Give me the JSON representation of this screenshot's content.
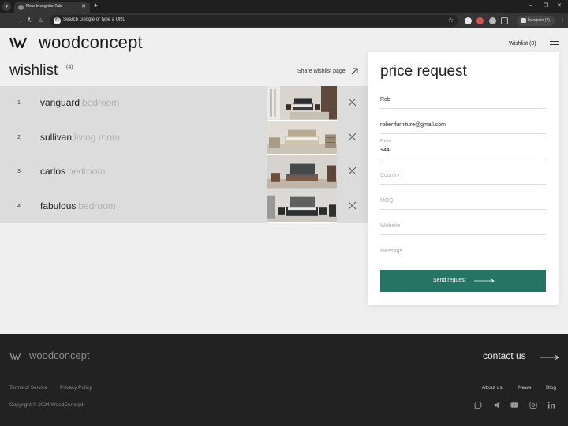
{
  "browser": {
    "tab_title": "New Incognito Tab",
    "address_placeholder": "Search Google or type a URL",
    "incognito_label": "Incognito (2)"
  },
  "header": {
    "logo": "woodconcept",
    "wishlist_link": "Wishlist (0)"
  },
  "wishlist": {
    "title": "wishlist",
    "count": "(4)",
    "share_label": "Share wishlist page",
    "items": [
      {
        "num": "1",
        "name": "vanguard",
        "category": "bedroom"
      },
      {
        "num": "2",
        "name": "sullivan",
        "category": "living room"
      },
      {
        "num": "3",
        "name": "carlos",
        "category": "bedroom"
      },
      {
        "num": "4",
        "name": "fabulous",
        "category": "bedroom"
      }
    ]
  },
  "price_request": {
    "title": "price request",
    "fields": {
      "name": {
        "value": "Rob"
      },
      "email": {
        "value": "robertfurniture@gmail.com"
      },
      "phone": {
        "label": "Phone",
        "value": "+44|"
      },
      "country": {
        "placeholder": "Country"
      },
      "moq": {
        "placeholder": "MOQ"
      },
      "website": {
        "placeholder": "Website"
      },
      "message": {
        "placeholder": "Message"
      }
    },
    "send_label": "Send request",
    "button_color": "#247563"
  },
  "footer": {
    "logo": "woodconcept",
    "contact": "contact us",
    "terms": "Terms of Service",
    "privacy": "Privacy Policy",
    "copyright": "Copyright © 2024 WoodConcept",
    "links": [
      "About us",
      "News",
      "Blog"
    ],
    "social": [
      "whatsapp-icon",
      "telegram-icon",
      "youtube-icon",
      "instagram-icon",
      "linkedin-icon"
    ]
  }
}
